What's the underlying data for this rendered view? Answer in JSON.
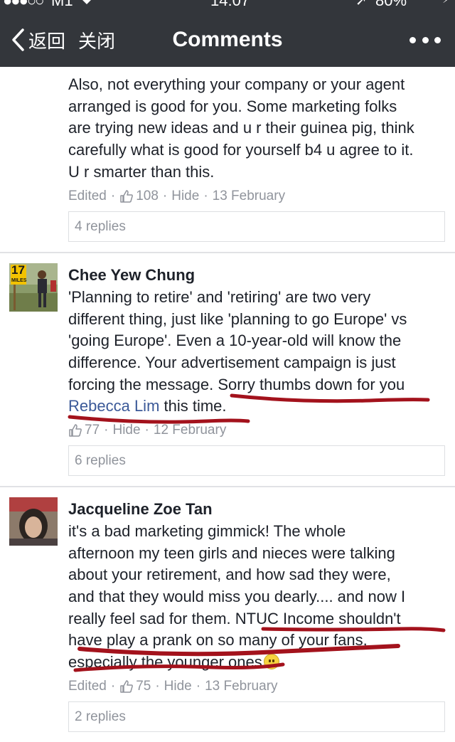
{
  "status_bar": {
    "signal": "●●●○○",
    "carrier": "M1",
    "wifi_icon": "wifi-icon",
    "time": "14:07",
    "location_icon": "➚",
    "battery_percent_text": "80%",
    "battery_level": 0.8,
    "charge_icon": "⚡"
  },
  "nav": {
    "back_label": "返回",
    "close_label": "关闭",
    "title": "Comments",
    "more_icon": "more-dots-icon"
  },
  "comments": [
    {
      "author": "",
      "lines": [
        "Also, not everything your company or your agent",
        "arranged is good for you. Some marketing folks",
        "are trying new ideas and u r their guinea pig, think",
        "carefully what is good for yourself b4 u agree to it.",
        "U r smarter than this."
      ],
      "edited": "Edited",
      "likes": "108",
      "hide": "Hide",
      "date": "13 February",
      "replies": "4 replies"
    },
    {
      "author": "Chee Yew Chung",
      "avatar_badge_top": "17",
      "avatar_badge_bottom": "MILES",
      "lines": [
        "'Planning to retire' and 'retiring' are two very",
        "different thing, just like 'planning to go Europe' vs",
        "'going Europe'. Even a 10-year-old will know the",
        "difference. Your advertisement campaign is just",
        "forcing the message. Sorry thumbs down for you"
      ],
      "mention": "Rebecca Lim",
      "mention_tail": " this time.",
      "likes": "77",
      "hide": "Hide",
      "date": "12 February",
      "replies": "6 replies"
    },
    {
      "author": "Jacqueline Zoe Tan",
      "lines": [
        "it's a bad marketing gimmick! The whole",
        "afternoon my teen girls and nieces were talking",
        "about your retirement, and how sad they were,",
        "and that they would miss you dearly.... and now I",
        "really feel sad for them. NTUC Income shouldn't",
        "have play a prank on so many of your fans,",
        "especially the younger ones"
      ],
      "emoji": "sad-face-emoji",
      "edited": "Edited",
      "likes": "75",
      "hide": "Hide",
      "date": "13 February",
      "replies": "2 replies"
    }
  ],
  "colors": {
    "nav_bg": "#33363b",
    "text": "#1d2129",
    "meta": "#90949c",
    "mention": "#3b5998",
    "underline_ink": "#a3121c"
  }
}
